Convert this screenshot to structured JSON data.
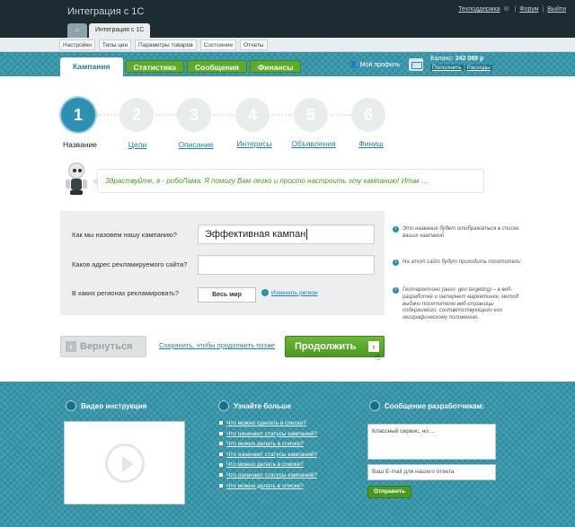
{
  "header": {
    "app_title": "Интеграция с 1С",
    "links": [
      "Техподдержка",
      "Форум",
      "Выйти"
    ],
    "tabs": [
      {
        "label": "Интеграция с 1С"
      }
    ]
  },
  "subnav": [
    "Настройки",
    "Типы цен",
    "Параметры товаров",
    "Состояние",
    "Отчеты"
  ],
  "main_tabs": [
    "Кампания",
    "Статистика",
    "Сообщения",
    "Финансы"
  ],
  "profile": {
    "label": "Мой профиль"
  },
  "balance": {
    "label": "Баланс:",
    "amount": "242 088 р",
    "topup": "Пополнить",
    "expenses": "Расходы"
  },
  "steps": [
    {
      "number": "1",
      "label": "Название",
      "active": true
    },
    {
      "number": "2",
      "label": "Цели"
    },
    {
      "number": "3",
      "label": "Описание"
    },
    {
      "number": "4",
      "label": "Интересы"
    },
    {
      "number": "5",
      "label": "Объявления"
    },
    {
      "number": "6",
      "label": "Финиш"
    }
  ],
  "greeting": "Здраствуйте, я - робоЛама. Я помогу Вам легко и просто настроить эту кампанию! Итак ...",
  "form": {
    "name_label": "Как мы назовем нашу кампанию?",
    "name_value": "Эффективная кампан",
    "site_label": "Каков адрес рекламируемого сайта?",
    "site_value": "",
    "regions_label": "В каких регионах рекламировать?",
    "regions_value": "Весь мир",
    "change_regions": "Изменить регион"
  },
  "hints": [
    "Это название будет отображаться в списке ваших кампаний",
    "На этот сайт будут приходить посетители",
    "Геотаргетинг (англ. geo targeting) – в веб-разработке и интернет маркетинге, метод выдачи посетителю веб-страницы содержимого, соответствующего его географическому положению."
  ],
  "actions": {
    "back": "Вернуться",
    "save_link": "Сохранить, чтобы продолжить позже",
    "next": "Продолжить"
  },
  "footer": {
    "video_title": "Видео инструкция",
    "learn_title": "Узнайте больше",
    "learn_items": [
      "Что можно сделать в списке?",
      "Что означают статусы кампаний?",
      "Что можно делать в списке?",
      "Что означают статусы кампаний?",
      "Что можно делать в списке?",
      "Что означают статусы кампаний?",
      "Что можно делать в списке?"
    ],
    "dev_title": "Сообщение разработчикам:",
    "message_value": "Классный сервис, но ...",
    "email_placeholder": "Ваш E-mail для нашего ответа",
    "send": "Отправить"
  }
}
